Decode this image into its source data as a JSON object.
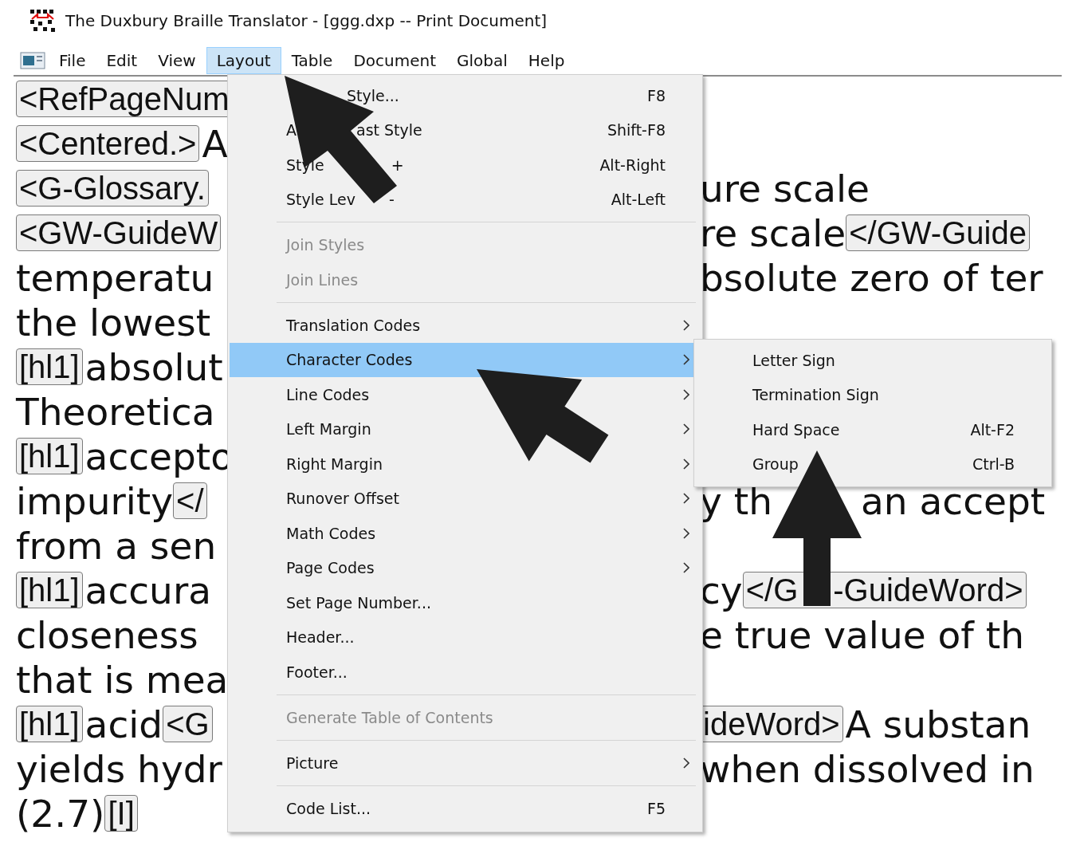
{
  "window": {
    "title": "The Duxbury Braille Translator - [ggg.dxp -- Print Document]"
  },
  "menu_bar": [
    {
      "label": "File",
      "selected": false
    },
    {
      "label": "Edit",
      "selected": false
    },
    {
      "label": "View",
      "selected": false
    },
    {
      "label": "Layout",
      "selected": true
    },
    {
      "label": "Table",
      "selected": false
    },
    {
      "label": "Document",
      "selected": false
    },
    {
      "label": "Global",
      "selected": false
    },
    {
      "label": "Help",
      "selected": false
    }
  ],
  "document": {
    "rows": [
      {
        "left": [
          {
            "kind": "tag",
            "text": "<RefPageNum"
          }
        ],
        "right": []
      },
      {
        "left": [
          {
            "kind": "tag",
            "text": "<Centered.>"
          },
          {
            "kind": "text",
            "text": "A"
          }
        ],
        "right": []
      },
      {
        "left": [
          {
            "kind": "tag",
            "text": "<G-Glossary."
          }
        ],
        "right": [
          {
            "kind": "text",
            "text": "ure scale"
          }
        ]
      },
      {
        "left": [
          {
            "kind": "tag",
            "text": "<GW-GuideW"
          }
        ],
        "right": [
          {
            "kind": "text",
            "text": "re scale"
          },
          {
            "kind": "tag",
            "text": "</GW-Guide"
          }
        ]
      },
      {
        "left": [
          {
            "kind": "text",
            "text": "temperatu"
          }
        ],
        "right": [
          {
            "kind": "text",
            "text": "bsolute zero of ter"
          }
        ]
      },
      {
        "left": [
          {
            "kind": "text",
            "text": "the lowest"
          }
        ],
        "right": []
      },
      {
        "left": [
          {
            "kind": "tag",
            "text": "[hl1]"
          },
          {
            "kind": "text",
            "text": "absolut"
          }
        ],
        "right": []
      },
      {
        "left": [
          {
            "kind": "text",
            "text": "Theoretica"
          }
        ],
        "right": []
      },
      {
        "left": [
          {
            "kind": "tag",
            "text": "[hl1]"
          },
          {
            "kind": "text",
            "text": "accepto"
          }
        ],
        "right": []
      },
      {
        "left": [
          {
            "kind": "text",
            "text": "impurity"
          },
          {
            "kind": "tag",
            "text": "</"
          }
        ],
        "right": [
          {
            "kind": "text",
            "text": "y th"
          },
          {
            "kind": "text",
            "text": "an accept"
          }
        ]
      },
      {
        "left": [
          {
            "kind": "text",
            "text": "from a sen"
          }
        ],
        "right": []
      },
      {
        "left": [
          {
            "kind": "tag",
            "text": "[hl1]"
          },
          {
            "kind": "text",
            "text": "accura"
          }
        ],
        "right": [
          {
            "kind": "text",
            "text": "cy"
          },
          {
            "kind": "tag",
            "parts": [
              "</G",
              "-GuideWord>"
            ]
          }
        ]
      },
      {
        "left": [
          {
            "kind": "text",
            "text": "closeness"
          }
        ],
        "right": [
          {
            "kind": "text",
            "text": "e true value of th"
          }
        ]
      },
      {
        "left": [
          {
            "kind": "text",
            "text": "that is mea"
          }
        ],
        "right": []
      },
      {
        "left": [
          {
            "kind": "tag",
            "text": "[hl1]"
          },
          {
            "kind": "text",
            "text": "acid"
          },
          {
            "kind": "tag",
            "text": "<G"
          }
        ],
        "right": [
          {
            "kind": "tag",
            "text": "ideWord>"
          },
          {
            "kind": "text",
            "text": "A substan"
          }
        ]
      },
      {
        "left": [
          {
            "kind": "text",
            "text": "yields hydr"
          }
        ],
        "right": [
          {
            "kind": "text",
            "text": "when dissolved in"
          }
        ]
      },
      {
        "left": [
          {
            "kind": "text",
            "text": "(2.7)"
          },
          {
            "kind": "tag",
            "text": "[I]"
          }
        ],
        "right": []
      }
    ]
  },
  "layout_menu": {
    "items": [
      {
        "kind": "item",
        "label_parts": [
          "Style..."
        ],
        "shortcut": "F8",
        "disabled": false,
        "has_submenu": false,
        "selected": false
      },
      {
        "kind": "item",
        "label_parts": [
          "A",
          "ast Style"
        ],
        "shortcut": "Shift-F8",
        "disabled": false,
        "has_submenu": false,
        "selected": false
      },
      {
        "kind": "item",
        "label_parts": [
          "Style",
          "+"
        ],
        "shortcut": "Alt-Right",
        "disabled": false,
        "has_submenu": false,
        "selected": false
      },
      {
        "kind": "item",
        "label_parts": [
          "Style Lev",
          "-"
        ],
        "shortcut": "Alt-Left",
        "disabled": false,
        "has_submenu": false,
        "selected": false
      },
      {
        "kind": "separator"
      },
      {
        "kind": "item",
        "label": "Join Styles",
        "disabled": true,
        "has_submenu": false,
        "selected": false
      },
      {
        "kind": "item",
        "label": "Join Lines",
        "disabled": true,
        "has_submenu": false,
        "selected": false
      },
      {
        "kind": "separator"
      },
      {
        "kind": "item",
        "label": "Translation Codes",
        "disabled": false,
        "has_submenu": true,
        "selected": false
      },
      {
        "kind": "item",
        "label": "Character Codes",
        "disabled": false,
        "has_submenu": true,
        "selected": true
      },
      {
        "kind": "item",
        "label": "Line Codes",
        "disabled": false,
        "has_submenu": true,
        "selected": false
      },
      {
        "kind": "item",
        "label": "Left Margin",
        "disabled": false,
        "has_submenu": true,
        "selected": false
      },
      {
        "kind": "item",
        "label": "Right Margin",
        "disabled": false,
        "has_submenu": true,
        "selected": false
      },
      {
        "kind": "item",
        "label": "Runover Offset",
        "disabled": false,
        "has_submenu": true,
        "selected": false
      },
      {
        "kind": "item",
        "label": "Math Codes",
        "disabled": false,
        "has_submenu": true,
        "selected": false
      },
      {
        "kind": "item",
        "label": "Page Codes",
        "disabled": false,
        "has_submenu": true,
        "selected": false
      },
      {
        "kind": "item",
        "label": "Set Page Number...",
        "disabled": false,
        "has_submenu": false,
        "selected": false
      },
      {
        "kind": "item",
        "label": "Header...",
        "disabled": false,
        "has_submenu": false,
        "selected": false
      },
      {
        "kind": "item",
        "label": "Footer...",
        "disabled": false,
        "has_submenu": false,
        "selected": false
      },
      {
        "kind": "separator"
      },
      {
        "kind": "item",
        "label": "Generate Table of Contents",
        "disabled": true,
        "has_submenu": false,
        "selected": false
      },
      {
        "kind": "separator"
      },
      {
        "kind": "item",
        "label": "Picture",
        "disabled": false,
        "has_submenu": true,
        "selected": false
      },
      {
        "kind": "separator"
      },
      {
        "kind": "item",
        "label": "Code List...",
        "shortcut": "F5",
        "disabled": false,
        "has_submenu": false,
        "selected": false
      }
    ]
  },
  "character_codes_menu": {
    "items": [
      {
        "kind": "item",
        "label": "Letter Sign",
        "disabled": false,
        "has_submenu": false,
        "selected": false
      },
      {
        "kind": "item",
        "label": "Termination Sign",
        "disabled": false,
        "has_submenu": false,
        "selected": false
      },
      {
        "kind": "item",
        "label": "Hard Space",
        "shortcut": "Alt-F2",
        "disabled": false,
        "has_submenu": false,
        "selected": false
      },
      {
        "kind": "item",
        "label": "Group",
        "shortcut": "Ctrl-B",
        "disabled": false,
        "has_submenu": false,
        "selected": false
      }
    ]
  }
}
